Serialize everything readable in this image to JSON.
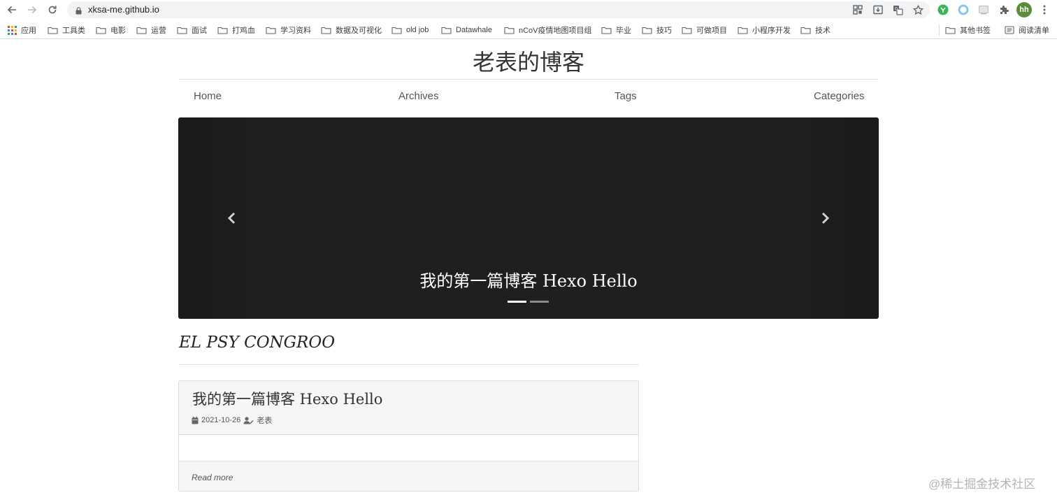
{
  "browser": {
    "url": "xksa-me.github.io",
    "profile_initials": "hh",
    "icons": [
      "back-arrow-icon",
      "forward-arrow-icon",
      "reload-icon",
      "lock-icon",
      "qr-code-icon",
      "install-icon",
      "translate-icon",
      "star-icon",
      "extension-green-icon",
      "extension-blue-ring-icon",
      "extension-window-icon",
      "puzzle-icon",
      "kebab-menu-icon"
    ]
  },
  "bookmarks": {
    "apps": "应用",
    "folders": [
      "工具类",
      "电影",
      "运营",
      "面试",
      "打鸡血",
      "学习资料",
      "数据及可视化",
      "old job",
      "Datawhale",
      "nCoV疫情地图项目组",
      "毕业",
      "技巧",
      "可做项目",
      "小程序开发",
      "技术"
    ],
    "other": "其他书签",
    "reading_list": "阅读清单"
  },
  "site": {
    "title": "老表的博客",
    "nav": {
      "home": "Home",
      "archives": "Archives",
      "tags": "Tags",
      "categories": "Categories"
    },
    "carousel": {
      "caption": "我的第一篇博客 Hexo Hello",
      "slide_count": 2,
      "active_index": 0
    },
    "motto": "EL PSY CONGROO",
    "post": {
      "title": "我的第一篇博客 Hexo Hello",
      "date": "2021-10-26",
      "author": "老表",
      "read_more": "Read more"
    }
  },
  "watermark": "@稀土掘金技术社区",
  "colors": {
    "carousel_bg": "#1e1f21",
    "profile_avatar": "#5b8c3a",
    "card_header_bg": "#f6f6f6"
  }
}
